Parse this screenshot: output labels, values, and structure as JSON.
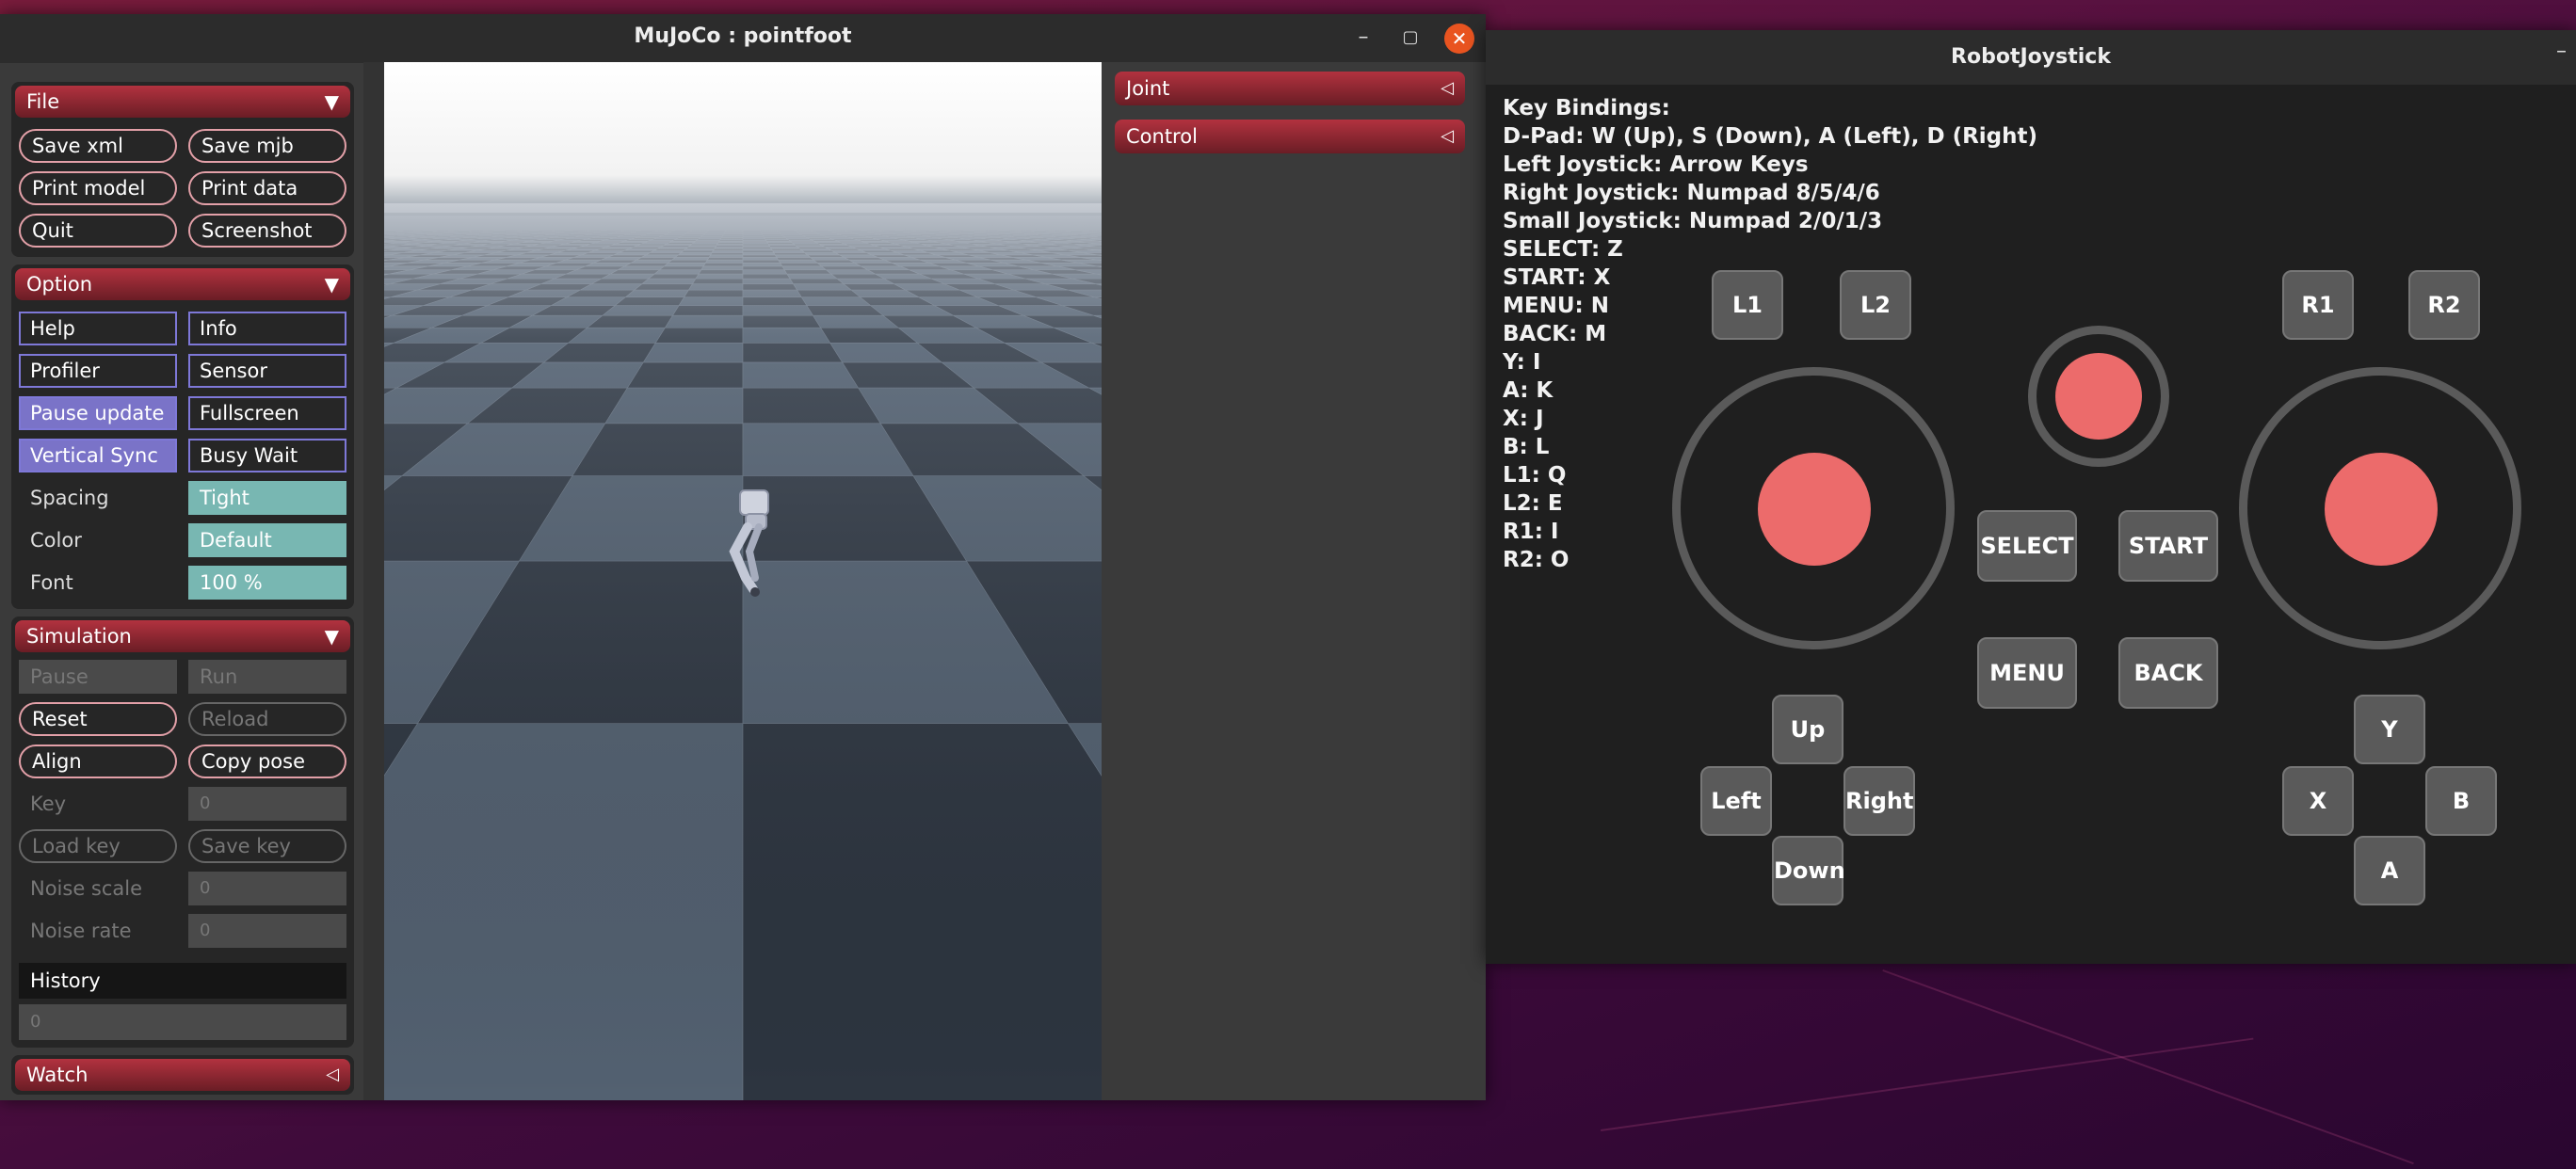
{
  "mujoco": {
    "title": "MuJoCo : pointfoot",
    "window_controls": {
      "minimize": "–",
      "maximize": "▢",
      "close": "✕"
    },
    "file": {
      "header": "File",
      "buttons": [
        "Save xml",
        "Save mjb",
        "Print model",
        "Print data",
        "Quit",
        "Screenshot"
      ]
    },
    "option": {
      "header": "Option",
      "checks": [
        {
          "label": "Help",
          "on": false
        },
        {
          "label": "Info",
          "on": false
        },
        {
          "label": "Profiler",
          "on": false
        },
        {
          "label": "Sensor",
          "on": false
        },
        {
          "label": "Pause update",
          "on": true
        },
        {
          "label": "Fullscreen",
          "on": false
        },
        {
          "label": "Vertical Sync",
          "on": true
        },
        {
          "label": "Busy Wait",
          "on": false
        }
      ],
      "spacing_label": "Spacing",
      "spacing_value": "Tight",
      "color_label": "Color",
      "color_value": "Default",
      "font_label": "Font",
      "font_value": "100 %"
    },
    "simulation": {
      "header": "Simulation",
      "pause": "Pause",
      "run": "Run",
      "reset": "Reset",
      "reload": "Reload",
      "align": "Align",
      "copy_pose": "Copy pose",
      "key_label": "Key",
      "key_value": "0",
      "load_key": "Load key",
      "save_key": "Save key",
      "noise_scale_label": "Noise scale",
      "noise_scale_value": "0",
      "noise_rate_label": "Noise rate",
      "noise_rate_value": "0",
      "history_label": "History",
      "history_value": "0"
    },
    "watch": {
      "header": "Watch"
    },
    "right_panel": {
      "joint": "Joint",
      "control": "Control"
    }
  },
  "joystick": {
    "title": "RobotJoystick",
    "minimize": "–",
    "key_bindings": [
      "Key Bindings:",
      "D-Pad: W (Up), S (Down), A (Left), D (Right)",
      "Left Joystick: Arrow Keys",
      "Right Joystick: Numpad 8/5/4/6",
      "Small Joystick: Numpad 2/0/1/3",
      "SELECT: Z",
      "START: X",
      "MENU: N",
      "BACK: M",
      "Y: I",
      "A: K",
      "X: J",
      "B: L",
      "L1: Q",
      "L2: E",
      "R1: I",
      "R2: O"
    ],
    "buttons": {
      "l1": "L1",
      "l2": "L2",
      "r1": "R1",
      "r2": "R2",
      "select": "SELECT",
      "start": "START",
      "menu": "MENU",
      "back": "BACK",
      "up": "Up",
      "down": "Down",
      "left": "Left",
      "right": "Right",
      "y": "Y",
      "x": "X",
      "b": "B",
      "a": "A"
    },
    "colors": {
      "knob": "#ec6b6b",
      "ring": "#5a5a5a",
      "button": "#5a5a5a"
    }
  }
}
